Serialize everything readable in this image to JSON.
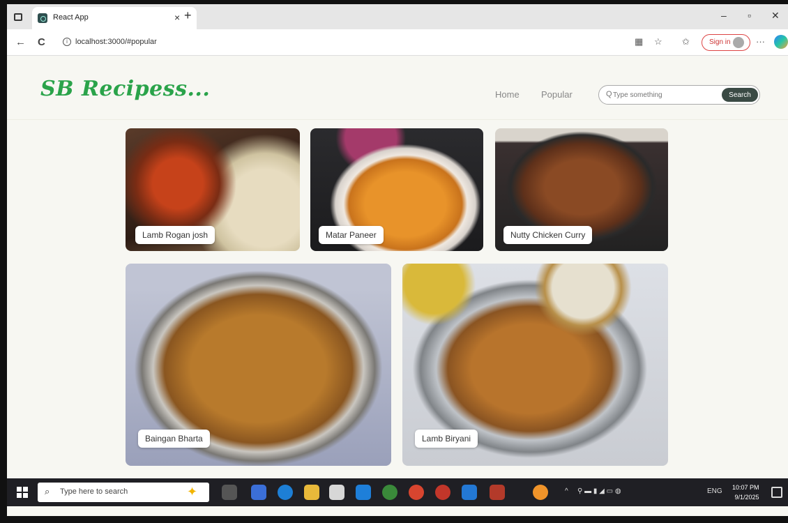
{
  "browser": {
    "tab_title": "React App",
    "tab_close": "×",
    "new_tab": "+",
    "url": "localhost:3000/#popular",
    "signin_label": "Sign in",
    "window_controls": {
      "minimize": "–",
      "maximize": "▫",
      "close": "✕"
    },
    "nav_icons": {
      "back": "←",
      "reload": "C"
    }
  },
  "app": {
    "logo": "SB Recipess...",
    "nav": [
      {
        "label": "Home"
      },
      {
        "label": "Popular"
      }
    ],
    "search": {
      "placeholder": "Type something",
      "button_label": "Search"
    }
  },
  "recipes": [
    {
      "name": "Lamb Rogan josh"
    },
    {
      "name": "Matar Paneer"
    },
    {
      "name": "Nutty Chicken Curry"
    },
    {
      "name": "Baingan Bharta"
    },
    {
      "name": "Lamb Biryani"
    }
  ],
  "taskbar": {
    "search_placeholder": "Type here to search",
    "tray_lang": "ENG",
    "time": "10:07 PM",
    "date": "9/1/2025"
  },
  "colors": {
    "logo": "#2aa34a",
    "search_button": "#3a4a44",
    "signin_border": "#dd4444",
    "page_background": "#f7f7f2"
  }
}
